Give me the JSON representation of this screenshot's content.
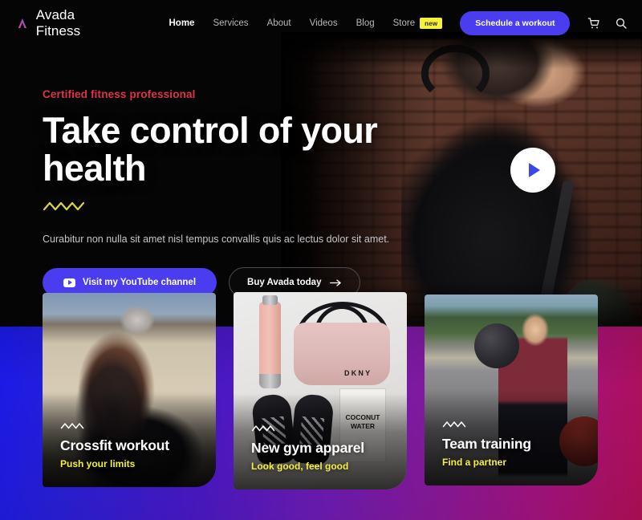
{
  "header": {
    "brand": {
      "name": "Avada Fitness",
      "logo_icon": "avada-a-logo",
      "logo_gradient_from": "#e0407f",
      "logo_gradient_to": "#7b5cf0"
    },
    "nav": [
      {
        "label": "Home",
        "active": true,
        "badge": null
      },
      {
        "label": "Services",
        "active": false,
        "badge": null
      },
      {
        "label": "About",
        "active": false,
        "badge": null
      },
      {
        "label": "Videos",
        "active": false,
        "badge": null
      },
      {
        "label": "Blog",
        "active": false,
        "badge": null
      },
      {
        "label": "Store",
        "active": false,
        "badge": "new"
      }
    ],
    "cta_label": "Schedule a workout",
    "cta_color": "#4a3df0",
    "badge_color": "#f5f13a",
    "icons": [
      {
        "name": "cart-icon"
      },
      {
        "name": "search-icon"
      }
    ]
  },
  "hero": {
    "eyebrow": "Certified fitness professional",
    "eyebrow_color": "#e0324a",
    "headline": "Take control of your health",
    "lede": "Curabitur non nulla sit amet nisl tempus convallis quis ac lectus dolor sit amet.",
    "buttons": {
      "youtube_label": "Visit my YouTube channel",
      "youtube_icon": "youtube-play-icon",
      "buy_label": "Buy Avada today",
      "buy_icon": "arrow-right-icon"
    },
    "play_button": {
      "icon": "play-icon",
      "icon_color": "#3d47e8"
    },
    "squiggle_color": "#d8d648"
  },
  "cards": [
    {
      "title": "Crossfit workout",
      "subtitle": "Push your limits",
      "photo": "woman-drinking-water"
    },
    {
      "title": "New gym apparel",
      "subtitle": "Look good, feel good",
      "photo": "gym-apparel-flatlay"
    },
    {
      "title": "Team training",
      "subtitle": "Find a partner",
      "photo": "woman-medicine-ball"
    }
  ],
  "card_photo_text": {
    "dkny": "DKNY",
    "coconut_line1": "COCONUT",
    "coconut_line2": "WATER"
  },
  "theme": {
    "gradient_start": "#1a1ae8",
    "gradient_mid": "#6c1bb3",
    "gradient_end": "#b00f55",
    "accent_yellow": "#f3ef3f",
    "hero_background": "#050505"
  }
}
